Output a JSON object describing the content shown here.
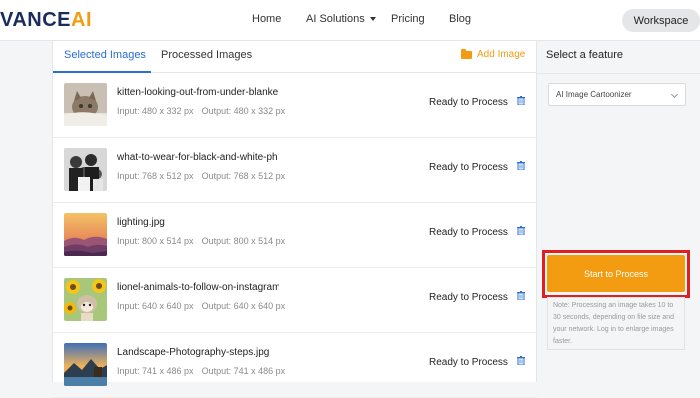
{
  "header": {
    "logo_left": "VANCE",
    "logo_right": "AI",
    "nav": {
      "home": "Home",
      "ai_solutions": "AI Solutions",
      "pricing": "Pricing",
      "blog": "Blog"
    },
    "workspace": "Workspace"
  },
  "tabs": {
    "selected": "Selected Images",
    "processed": "Processed Images",
    "add_image": "Add Image"
  },
  "images": [
    {
      "name": "kitten-looking-out-from-under-blanke",
      "input": "Input: 480 x 332 px",
      "output": "Output: 480 x 332 px",
      "status": "Ready to Process"
    },
    {
      "name": "what-to-wear-for-black-and-white-ph",
      "input": "Input: 768 x 512 px",
      "output": "Output: 768 x 512 px",
      "status": "Ready to Process"
    },
    {
      "name": "lighting.jpg",
      "input": "Input: 800 x 514 px",
      "output": "Output: 800 x 514 px",
      "status": "Ready to Process"
    },
    {
      "name": "lionel-animals-to-follow-on-instagram",
      "input": "Input: 640 x 640 px",
      "output": "Output: 640 x 640 px",
      "status": "Ready to Process"
    },
    {
      "name": "Landscape-Photography-steps.jpg",
      "input": "Input: 741 x 486 px",
      "output": "Output: 741 x 486 px",
      "status": "Ready to Process"
    }
  ],
  "sidebar": {
    "title": "Select a feature",
    "selected_feature": "AI Image Cartoonizer",
    "start_button": "Start to Process",
    "note": "Note: Processing an image takes 10 to 30 seconds, depending on file size and your network. Log in to enlarge images faster."
  },
  "colors": {
    "brand_orange": "#f39c12",
    "brand_navy": "#1a2c5b",
    "tab_blue": "#2a6ed6",
    "highlight_red": "#e02020"
  }
}
